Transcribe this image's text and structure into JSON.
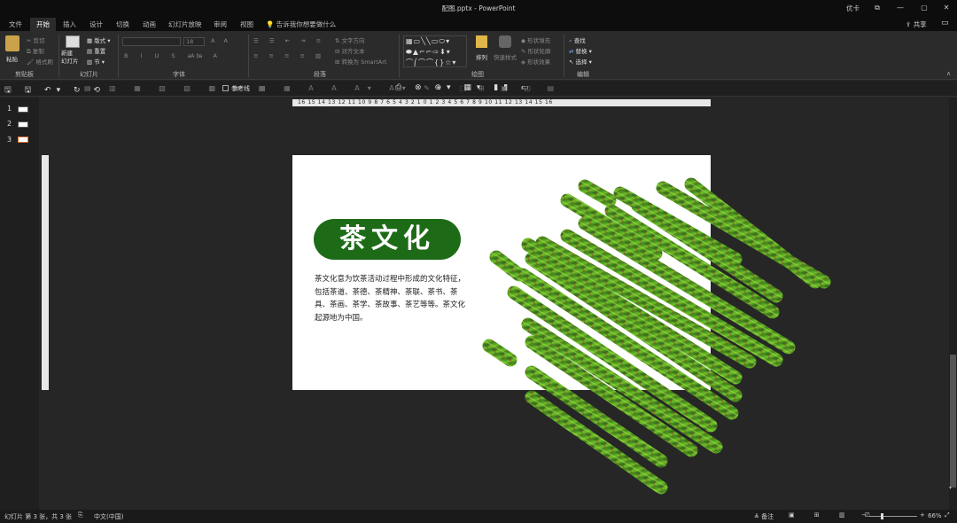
{
  "window": {
    "title": "配图.pptx  -  PowerPoint",
    "user": "优卡",
    "controls": [
      "⧉",
      "—",
      "▢",
      "✕"
    ]
  },
  "tabs": [
    "文件",
    "开始",
    "插入",
    "设计",
    "切换",
    "动画",
    "幻灯片放映",
    "审阅",
    "视图"
  ],
  "active_tab": "开始",
  "tell_me": "告诉我你想要做什么",
  "share": "共享",
  "ribbon": {
    "clipboard": {
      "label": "剪贴板",
      "paste": "粘贴",
      "cut": "剪切",
      "copy": "复制",
      "format_painter": "格式刷"
    },
    "slides": {
      "label": "幻灯片",
      "new_slide": "新建\n幻灯片",
      "layout": "版式",
      "reset": "重置",
      "section": "节"
    },
    "font": {
      "label": "字体",
      "size": "18"
    },
    "paragraph": {
      "label": "段落",
      "text_direction": "文字方向",
      "align_text": "对齐文本",
      "smartart": "转换为 SmartArt"
    },
    "drawing": {
      "label": "绘图",
      "arrange": "排列",
      "quick_styles": "快速样式",
      "shape_fill": "形状填充",
      "shape_outline": "形状轮廓",
      "shape_effects": "形状效果"
    },
    "editing": {
      "label": "编辑",
      "find": "查找",
      "replace": "替换",
      "select": "选择"
    }
  },
  "qat": {
    "gridlines": "参考线"
  },
  "ruler_h": "16 15 14 13 12 11 10 9 8 7 6 5 4 3 2 1 0 1 2 3 4 5 6 7 8 9 10 11 12 13 14 15 16",
  "slides": [
    {
      "num": "1"
    },
    {
      "num": "2"
    },
    {
      "num": "3",
      "selected": true
    }
  ],
  "slide": {
    "title": "茶文化",
    "body": "茶文化意为饮茶活动过程中形成的文化特征，包括茶道、茶德、茶精神、茶联、茶书、茶具、茶画、茶学、茶故事、茶艺等等。茶文化起源地为中国。",
    "accent_color": "#1d6b16"
  },
  "status": {
    "slide_info": "幻灯片 第 3 张，共 3 张",
    "language": "中文(中国)",
    "notes": "备注",
    "zoom": "66%"
  }
}
